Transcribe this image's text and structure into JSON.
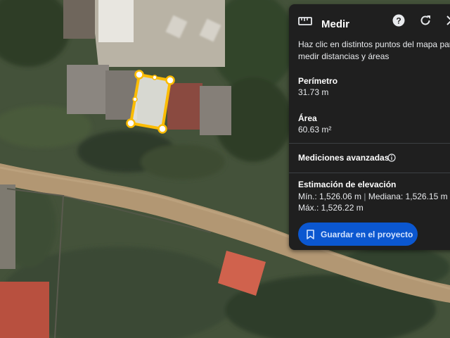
{
  "map": {
    "measurement_polygon_color": "#fbbc04",
    "vertex_fill": "#ffffff"
  },
  "panel": {
    "title": "Medir",
    "icons": {
      "ruler": "ruler-icon",
      "help": "help-icon",
      "reset": "refresh-icon",
      "close": "close-icon"
    },
    "instructions": "Haz clic en distintos puntos del mapa para medir distancias y áreas",
    "perimeter": {
      "label": "Perímetro",
      "value": "31.73 m"
    },
    "area": {
      "label": "Área",
      "value": "60.63 m²"
    },
    "advanced": {
      "label": "Mediciones avanzadas",
      "info_icon": "info-icon"
    },
    "elevation": {
      "label": "Estimación de elevación",
      "min": "Mín.: 1,526.06 m",
      "separator": "|",
      "median": "Mediana: 1,526.15 m",
      "max": "Máx.: 1,526.22 m"
    },
    "save_button": {
      "label": "Guardar en el proyecto",
      "icon": "bookmark-icon"
    },
    "colors": {
      "background": "#1f1f1f",
      "button": "#0b57d0",
      "button_text": "#d3e3fd"
    }
  }
}
